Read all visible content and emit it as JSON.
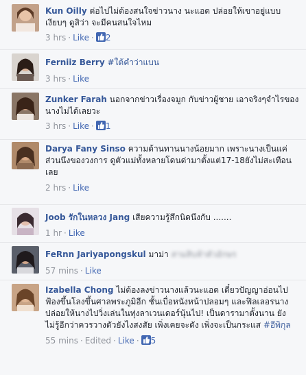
{
  "comments": [
    {
      "author": "Kun Oilly",
      "text": "ต่อไปไม่ต้องสนใจข่าวนาง นะแอด ปล่อยให้เขาอยู่แบบเงียบๆ ดูสิว่า จะมีคนสนใจไหม",
      "time": "3 hrs",
      "like_label": "Like",
      "likes": "2"
    },
    {
      "author": "Ferniiz Berry",
      "text": "#ใต้คำว่าแบน",
      "time": "3 hrs",
      "like_label": "Like"
    },
    {
      "author": "Zunker Farah",
      "text": "นอกจากข่าวเรื่องจมูก กับข่าวผู้ชาย เอาจริงๆจำไรของนางไม่ได้เลยวะ",
      "time": "3 hrs",
      "like_label": "Like",
      "likes": "1"
    },
    {
      "author": "Darya Fany Sinso",
      "text": "ความต้านทานนางน้อยมาก เพราะนางเป็นแค่ส่วนนึงของวงการ ดูตัวแม่ทั้งหลายโดนด่ามาตั้งแต่17-18ยังไม่สะเทือนเลย",
      "time": "2 hrs",
      "like_label": "Like"
    },
    {
      "author": "Joob รักในหลวง Jang",
      "text": "เสียความรู้สึกนิดนึงกับ .......",
      "time": "1 hr",
      "like_label": "Like"
    },
    {
      "author": "FeRnn Jariyapongskul",
      "text": "มาม่า",
      "time": "57 mins",
      "like_label": "Like"
    },
    {
      "author": "Izabella Chong",
      "text": "ไม่ต้องลงข่าวนางแล้วนะแอด เดี๋ยวปัญญาอ่อนไปฟ้องขึ้นโลงขึ้นศาลพระภูมิอีก ชั้นเบื่อหนังหน้าปลอมๆ และฟิลเลอรนาง ปล่อยให้นางไปวิ่งเล่นในทุ่งลาเวนเดอร์นุ้นไป! เป็นดารามาตั้งนาน ยังไม่รู้อีกว่าควรวางตัวยังไงสงสัย เพิ่งเคยจะดัง เพิ่งจะเป็นกระแส",
      "hashtag": "#อีพิกุล",
      "time": "55 mins",
      "edited_label": "Edited",
      "like_label": "Like",
      "likes": "5"
    }
  ],
  "colors": {
    "background": "#f6f7f9",
    "author": "#365899",
    "link": "#4267b2",
    "meta": "#90949c",
    "text": "#1d2129"
  }
}
